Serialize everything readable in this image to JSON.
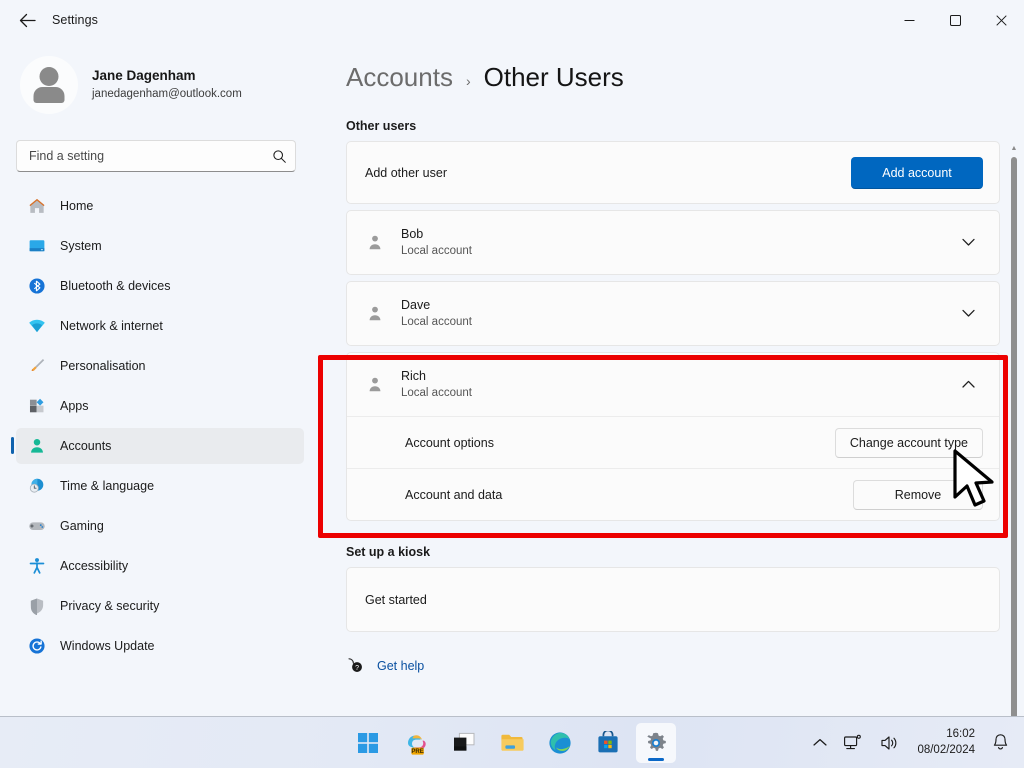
{
  "window": {
    "title": "Settings",
    "back_label": "Back",
    "minimize_label": "Minimise",
    "maximize_label": "Maximise",
    "close_label": "Close"
  },
  "sidebar": {
    "profile": {
      "name": "Jane Dagenham",
      "email": "janedagenham@outlook.com",
      "avatar_icon": "person-avatar-icon"
    },
    "search": {
      "placeholder": "Find a setting",
      "value": "",
      "icon": "search-icon"
    },
    "items": [
      {
        "label": "Home",
        "icon": "home-icon",
        "selected": false
      },
      {
        "label": "System",
        "icon": "system-icon",
        "selected": false
      },
      {
        "label": "Bluetooth & devices",
        "icon": "bluetooth-icon",
        "selected": false
      },
      {
        "label": "Network & internet",
        "icon": "network-icon",
        "selected": false
      },
      {
        "label": "Personalisation",
        "icon": "paintbrush-icon",
        "selected": false
      },
      {
        "label": "Apps",
        "icon": "apps-icon",
        "selected": false
      },
      {
        "label": "Accounts",
        "icon": "accounts-person-icon",
        "selected": true
      },
      {
        "label": "Time & language",
        "icon": "clock-globe-icon",
        "selected": false
      },
      {
        "label": "Gaming",
        "icon": "gamepad-icon",
        "selected": false
      },
      {
        "label": "Accessibility",
        "icon": "accessibility-icon",
        "selected": false
      },
      {
        "label": "Privacy & security",
        "icon": "shield-icon",
        "selected": false
      },
      {
        "label": "Windows Update",
        "icon": "update-refresh-icon",
        "selected": false
      }
    ]
  },
  "content": {
    "breadcrumb": {
      "parent": "Accounts",
      "separator": "›",
      "current": "Other Users"
    },
    "other_users_heading": "Other users",
    "add_other_user": {
      "label": "Add other user",
      "button_label": "Add account"
    },
    "users": [
      {
        "name": "Bob",
        "type": "Local account",
        "expanded": false,
        "chevron": "chevron-down-icon"
      },
      {
        "name": "Dave",
        "type": "Local account",
        "expanded": false,
        "chevron": "chevron-down-icon"
      },
      {
        "name": "Rich",
        "type": "Local account",
        "expanded": true,
        "chevron": "chevron-up-icon"
      }
    ],
    "rich_expanded": {
      "account_options_label": "Account options",
      "change_account_type_button": "Change account type",
      "account_and_data_label": "Account and data",
      "remove_button": "Remove"
    },
    "kiosk": {
      "heading": "Set up a kiosk",
      "get_started_label": "Get started"
    },
    "get_help": {
      "label": "Get help",
      "icon": "help-question-icon"
    },
    "highlight_color": "#ec0000",
    "accent_color": "#0067c0"
  },
  "taskbar": {
    "items": [
      {
        "name": "start",
        "icon": "windows-start-icon",
        "active": false
      },
      {
        "name": "copilot",
        "icon": "copilot-pre-icon",
        "active": false
      },
      {
        "name": "task-view",
        "icon": "task-view-icon",
        "active": false
      },
      {
        "name": "file-explorer",
        "icon": "folder-icon",
        "active": false
      },
      {
        "name": "edge",
        "icon": "edge-browser-icon",
        "active": false
      },
      {
        "name": "microsoft-store",
        "icon": "store-bag-icon",
        "active": false
      },
      {
        "name": "settings",
        "icon": "gear-icon",
        "active": true
      }
    ],
    "tray": {
      "show_hidden_icon": "chevron-up-icon",
      "network_icon": "network-tray-icon",
      "volume_icon": "speaker-icon",
      "notification_icon": "bell-icon",
      "time": "16:02",
      "date": "08/02/2024"
    }
  },
  "cursor": {
    "icon": "mouse-pointer-arrow"
  }
}
